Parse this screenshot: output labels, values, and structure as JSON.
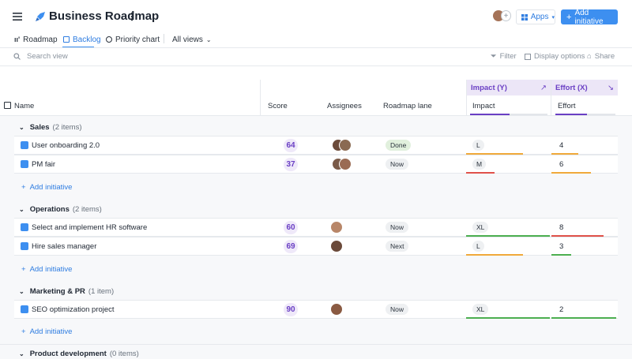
{
  "header": {
    "title": "Business Roadmap",
    "apps_label": "Apps",
    "add_initiative_label": "Add initiative"
  },
  "tabs": [
    {
      "label": "Roadmap"
    },
    {
      "label": "Backlog"
    },
    {
      "label": "Priority chart"
    },
    {
      "label": "All views"
    }
  ],
  "toolbar": {
    "search_placeholder": "Search view",
    "filter_label": "Filter",
    "display_options_label": "Display options",
    "share_label": "Share"
  },
  "columns": {
    "name": "Name",
    "score": "Score",
    "assignees": "Assignees",
    "roadmap_lane": "Roadmap lane",
    "impact_group": "Impact (Y)",
    "effort_group": "Effort (X)",
    "impact": "Impact",
    "effort": "Effort"
  },
  "groups": [
    {
      "name": "Sales",
      "count": "(2 items)",
      "add_label": "Add initiative",
      "rows": [
        {
          "name": "User onboarding 2.0",
          "score": "64",
          "lane": "Done",
          "impact": "L",
          "effort": "4"
        },
        {
          "name": "PM fair",
          "score": "37",
          "lane": "Now",
          "impact": "M",
          "effort": "6"
        }
      ]
    },
    {
      "name": "Operations",
      "count": "(2 items)",
      "add_label": "Add initiative",
      "rows": [
        {
          "name": "Select and implement HR software",
          "score": "60",
          "lane": "Now",
          "impact": "XL",
          "effort": "8"
        },
        {
          "name": "Hire sales manager",
          "score": "69",
          "lane": "Next",
          "impact": "L",
          "effort": "3"
        }
      ]
    },
    {
      "name": "Marketing & PR",
      "count": "(1 item)",
      "add_label": "Add initiative",
      "rows": [
        {
          "name": "SEO optimization project",
          "score": "90",
          "lane": "Now",
          "impact": "XL",
          "effort": "2"
        }
      ]
    },
    {
      "name": "Product development",
      "count": "(0 items)"
    }
  ],
  "colors": {
    "accent": "#3d8ff0",
    "score_purple": "#6a3fc4",
    "green": "#4caf50",
    "orange": "#f0a93a",
    "red": "#e0524a"
  }
}
